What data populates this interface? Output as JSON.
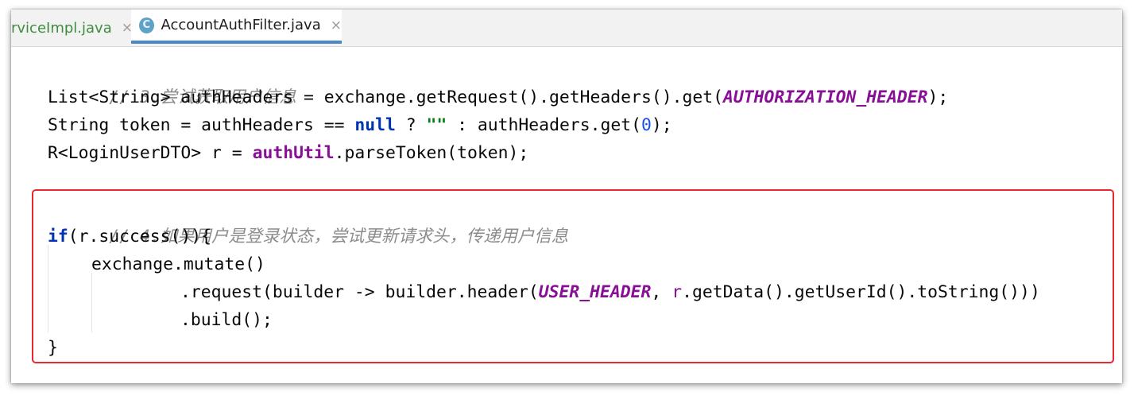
{
  "tabs": [
    {
      "label": "rviceImpl.java",
      "close": "×",
      "active": false
    },
    {
      "label": "AccountAuthFilter.java",
      "close": "×",
      "active": true,
      "icon": "C"
    }
  ],
  "code": {
    "comment3": "// 3.尝试获取用户信息",
    "l1_a": "List<String> authHeaders = exchange.getRequest().getHeaders().get(",
    "l1_const": "AUTHORIZATION_HEADER",
    "l1_b": ");",
    "l2_a": "String token = authHeaders == ",
    "l2_null": "null",
    "l2_b": " ? ",
    "l2_str": "\"\"",
    "l2_c": " : authHeaders.get(",
    "l2_num": "0",
    "l2_d": ");",
    "l3_a": "R<LoginUserDTO> r = ",
    "l3_field": "authUtil",
    "l3_b": ".parseToken(token);",
    "comment4": "// 4.如果用户是登录状态，尝试更新请求头，传递用户信息",
    "l4_if": "if",
    "l4_b": "(r.success()){",
    "l5": "exchange.mutate()",
    "l6_a": ".request(builder -> builder.header(",
    "l6_const": "USER_HEADER",
    "l6_b": ", ",
    "l6_r": "r",
    "l6_c": ".getData().getUserId().toString()))",
    "l7": ".build();",
    "l8": "}"
  },
  "colors": {
    "highlight_border": "#e8282e",
    "tab_underline": "#4a88c7",
    "keyword": "#0033b3",
    "comment": "#8c8c8c",
    "constant": "#871094",
    "string": "#067d17"
  }
}
